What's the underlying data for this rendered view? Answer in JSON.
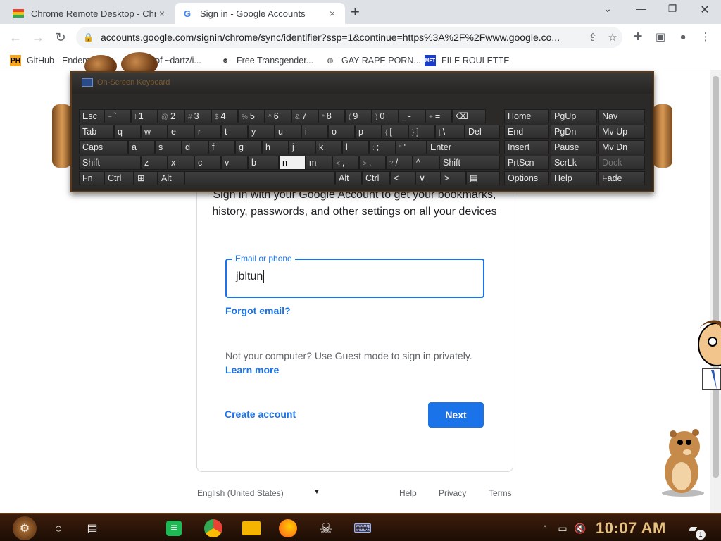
{
  "browser": {
    "tabs": [
      {
        "title": "Chrome Remote Desktop - Chro",
        "favicon": "chrome-remote-desktop-icon",
        "close": "×"
      },
      {
        "title": "Sign in - Google Accounts",
        "favicon": "google-g-icon",
        "close": "×"
      }
    ],
    "new_tab": "+",
    "url": "accounts.google.com/signin/chrome/sync/identifier?ssp=1&continue=https%3A%2F%2Fwww.google.co...",
    "bookmarks": [
      {
        "label": "GitHub - Endem",
        "icon": "PH"
      },
      {
        "label": "...x of ~dartz/i...",
        "icon": ""
      },
      {
        "label": "Free Transgender...",
        "icon": "mask-icon"
      },
      {
        "label": "GAY RAPE PORN...",
        "icon": "globe-icon"
      },
      {
        "label": "FILE ROULETTE",
        "icon": "MFT"
      }
    ]
  },
  "signin": {
    "subtitle": "Sign in with your Google Account to get your bookmarks, history, passwords, and other settings on all your devices",
    "email_label": "Email or phone",
    "email_value": "jbltun",
    "forgot_email": "Forgot email?",
    "guest_text": "Not your computer? Use Guest mode to sign in privately.",
    "learn_more": "Learn more",
    "create_account": "Create account",
    "next": "Next"
  },
  "footer": {
    "language": "English (United States)",
    "help": "Help",
    "privacy": "Privacy",
    "terms": "Terms"
  },
  "osk": {
    "title": "On-Screen Keyboard",
    "row1": [
      {
        "label": "Esc"
      },
      {
        "label": "`",
        "sh": "~"
      },
      {
        "label": "1",
        "sh": "!"
      },
      {
        "label": "2",
        "sh": "@"
      },
      {
        "label": "3",
        "sh": "#"
      },
      {
        "label": "4",
        "sh": "$"
      },
      {
        "label": "5",
        "sh": "%"
      },
      {
        "label": "6",
        "sh": "^"
      },
      {
        "label": "7",
        "sh": "&"
      },
      {
        "label": "8",
        "sh": "*"
      },
      {
        "label": "9",
        "sh": "("
      },
      {
        "label": "0",
        "sh": ")"
      },
      {
        "label": "-",
        "sh": "_"
      },
      {
        "label": "=",
        "sh": "+"
      },
      {
        "label": "⌫"
      }
    ],
    "row2": [
      {
        "label": "Tab"
      },
      {
        "label": "q"
      },
      {
        "label": "w"
      },
      {
        "label": "e"
      },
      {
        "label": "r"
      },
      {
        "label": "t"
      },
      {
        "label": "y"
      },
      {
        "label": "u"
      },
      {
        "label": "i"
      },
      {
        "label": "o"
      },
      {
        "label": "p"
      },
      {
        "label": "[",
        "sh": "{"
      },
      {
        "label": "]",
        "sh": "}"
      },
      {
        "label": "\\",
        "sh": "|"
      },
      {
        "label": "Del"
      }
    ],
    "row3": [
      {
        "label": "Caps"
      },
      {
        "label": "a"
      },
      {
        "label": "s"
      },
      {
        "label": "d"
      },
      {
        "label": "f"
      },
      {
        "label": "g"
      },
      {
        "label": "h"
      },
      {
        "label": "j"
      },
      {
        "label": "k"
      },
      {
        "label": "l"
      },
      {
        "label": ";",
        "sh": ":"
      },
      {
        "label": "'",
        "sh": "\""
      },
      {
        "label": "Enter"
      }
    ],
    "row4": [
      {
        "label": "Shift"
      },
      {
        "label": "z"
      },
      {
        "label": "x"
      },
      {
        "label": "c"
      },
      {
        "label": "v"
      },
      {
        "label": "b"
      },
      {
        "label": "n"
      },
      {
        "label": "m"
      },
      {
        "label": ",",
        "sh": "<"
      },
      {
        "label": ".",
        "sh": ">"
      },
      {
        "label": "/",
        "sh": "?"
      },
      {
        "label": "^"
      },
      {
        "label": "Shift"
      }
    ],
    "row5": [
      {
        "label": "Fn"
      },
      {
        "label": "Ctrl"
      },
      {
        "label": "⊞"
      },
      {
        "label": "Alt"
      },
      {
        "label": ""
      },
      {
        "label": "Alt"
      },
      {
        "label": "Ctrl"
      },
      {
        "label": "<"
      },
      {
        "label": "∨"
      },
      {
        "label": ">"
      },
      {
        "label": "▤"
      }
    ],
    "nav": [
      [
        "Home",
        "PgUp",
        "Nav"
      ],
      [
        "End",
        "PgDn",
        "Mv Up"
      ],
      [
        "Insert",
        "Pause",
        "Mv Dn"
      ],
      [
        "PrtScn",
        "ScrLk",
        "Dock"
      ],
      [
        "Options",
        "Help",
        "Fade"
      ]
    ],
    "active_key": "n"
  },
  "taskbar": {
    "clock": "10:07 AM",
    "notification_count": "1"
  }
}
